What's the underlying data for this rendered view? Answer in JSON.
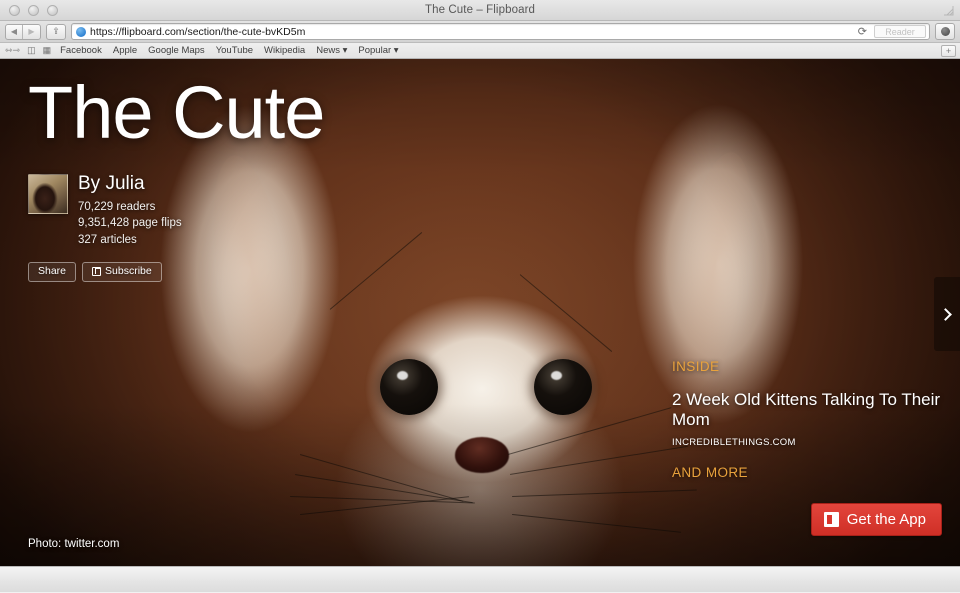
{
  "window": {
    "title": "The Cute – Flipboard",
    "traffic_lights": [
      "close",
      "minimize",
      "zoom"
    ]
  },
  "toolbar": {
    "back_label": "◀",
    "forward_label": "▶",
    "share_label": "⇪",
    "url": "https://flipboard.com/section/the-cute-bvKD5m",
    "reload_label": "⟳",
    "reader_label": "Reader",
    "settings_label": "gear"
  },
  "bookmarks": {
    "icons": [
      "sidebar-icon",
      "reading-list-icon",
      "top-sites-icon"
    ],
    "items": [
      {
        "label": "Facebook",
        "has_menu": false
      },
      {
        "label": "Apple",
        "has_menu": false
      },
      {
        "label": "Google Maps",
        "has_menu": false
      },
      {
        "label": "YouTube",
        "has_menu": false
      },
      {
        "label": "Wikipedia",
        "has_menu": false
      },
      {
        "label": "News ▾",
        "has_menu": true
      },
      {
        "label": "Popular ▾",
        "has_menu": true
      }
    ],
    "add_tab_label": "+"
  },
  "hero": {
    "title": "The Cute",
    "author": "By Julia",
    "stats": [
      "70,229 readers",
      "9,351,428 page flips",
      "327 articles"
    ],
    "share_button": "Share",
    "subscribe_button": "Subscribe",
    "photo_credit": "Photo: twitter.com"
  },
  "inside": {
    "label": "INSIDE",
    "article_title": "2 Week Old Kittens Talking To Their Mom",
    "article_source": "INCREDIBLETHINGS.COM",
    "and_more": "AND MORE"
  },
  "cta": {
    "label": "Get the App"
  },
  "navigation": {
    "next_label": "›"
  },
  "colors": {
    "accent_orange": "#E9A23C",
    "brand_red": "#D8352C",
    "hero_white": "#FFFFFF"
  }
}
